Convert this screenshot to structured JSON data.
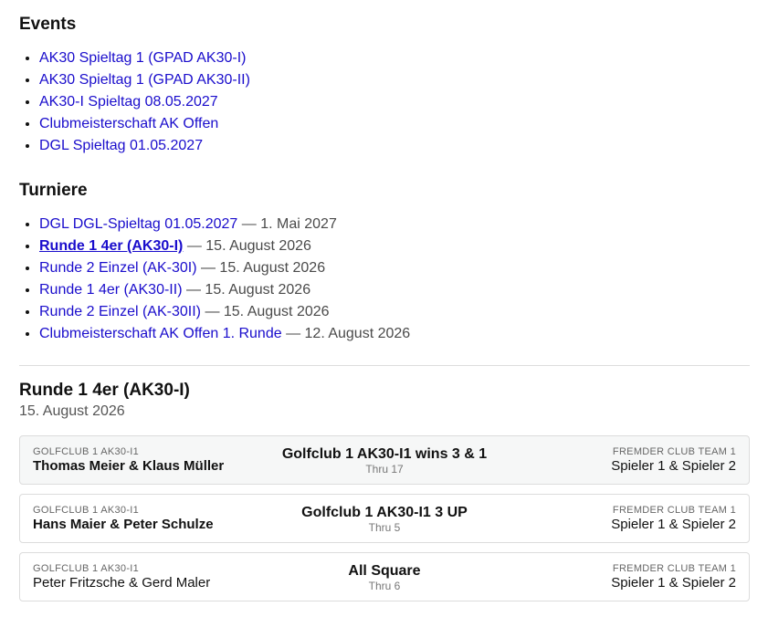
{
  "events": {
    "heading": "Events",
    "items": [
      {
        "label": "AK30 Spieltag 1 (GPAD AK30-I)"
      },
      {
        "label": "AK30 Spieltag 1 (GPAD AK30-II)"
      },
      {
        "label": "AK30-I Spieltag 08.05.2027"
      },
      {
        "label": "Clubmeisterschaft AK Offen"
      },
      {
        "label": "DGL Spieltag 01.05.2027"
      }
    ]
  },
  "turniere": {
    "heading": "Turniere",
    "items": [
      {
        "label": "DGL DGL-Spieltag 01.05.2027",
        "date": "— 1. Mai 2027"
      },
      {
        "label": "Runde 1 4er (AK30-I)",
        "date": "— 15. August 2026",
        "active": true
      },
      {
        "label": "Runde 2 Einzel (AK-30I)",
        "date": "— 15. August 2026"
      },
      {
        "label": "Runde 1 4er (AK30-II)",
        "date": "— 15. August 2026"
      },
      {
        "label": "Runde 2 Einzel (AK-30II)",
        "date": "— 15. August 2026"
      },
      {
        "label": "Clubmeisterschaft AK Offen 1. Runde",
        "date": "— 12. August 2026"
      }
    ]
  },
  "round": {
    "title": "Runde 1 4er (AK30-I)",
    "date": "15. August 2026",
    "matches": [
      {
        "home_team": "GOLFCLUB 1 AK30-I1",
        "home_players": "Thomas Meier & Klaus Müller",
        "result": "Golfclub 1 AK30-I1 wins 3 & 1",
        "thru": "Thru 17",
        "away_team": "FREMDER CLUB TEAM 1",
        "away_players": "Spieler 1 & Spieler 2"
      },
      {
        "home_team": "GOLFCLUB 1 AK30-I1",
        "home_players": "Hans Maier & Peter Schulze",
        "result": "Golfclub 1 AK30-I1 3 UP",
        "thru": "Thru 5",
        "away_team": "FREMDER CLUB TEAM 1",
        "away_players": "Spieler 1 & Spieler 2"
      },
      {
        "home_team": "GOLFCLUB 1 AK30-I1",
        "home_players": "Peter Fritzsche & Gerd Maler",
        "result": "All Square",
        "thru": "Thru 6",
        "away_team": "FREMDER CLUB TEAM 1",
        "away_players": "Spieler 1 & Spieler 2"
      }
    ]
  }
}
